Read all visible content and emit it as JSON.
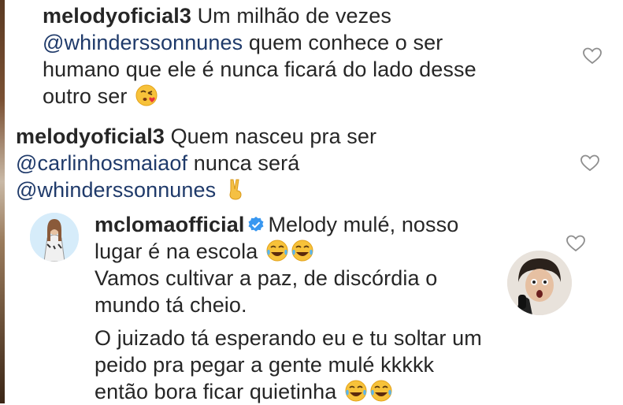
{
  "comments": [
    {
      "username": "melodyoficial3",
      "lines": [
        {
          "text": "Um milhão de vezes"
        },
        {
          "mention": "@whinderssonnunes",
          "text": "quem conhece o ser"
        },
        {
          "text": "humano que ele é nunca ficará do lado desse"
        },
        {
          "text": "outro ser"
        }
      ],
      "emoji": "kissing-heart-emoji"
    },
    {
      "username": "melodyoficial3",
      "lines": [
        {
          "text": "Quem nasceu pra ser"
        },
        {
          "mention": "@carlinhosmaiaof",
          "text": "nunca será"
        },
        {
          "mention": "@whinderssonnunes"
        }
      ],
      "emoji": "victory-hand-emoji"
    },
    {
      "username": "mcloma​official",
      "verified": true,
      "lines": [
        {
          "text": "Melody mulé, nosso"
        },
        {
          "text": "lugar é na escola"
        },
        {
          "text": "Vamos cultivar a paz, de discórdia o"
        },
        {
          "text": "mundo tá cheio."
        },
        {
          "text": "O juizado tá esperando eu e tu soltar um"
        },
        {
          "text": "peido pra pegar a gente mulé kkkkk"
        },
        {
          "text": "então bora ficar quietinha"
        }
      ],
      "emoji": "joy-emoji"
    }
  ],
  "icons": {
    "like": "heart-outline-icon",
    "verified": "verified-badge-icon"
  },
  "colors": {
    "text": "#262626",
    "mention": "#1f3a6a",
    "verified": "#3897f0"
  }
}
